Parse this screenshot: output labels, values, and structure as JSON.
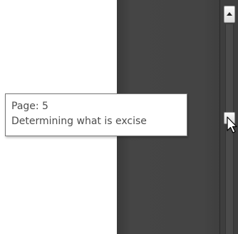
{
  "tooltip": {
    "page_label": "Page: 5",
    "heading": "Determining what is excise"
  },
  "scrollbar": {
    "up_arrow_icon": "triangle-up-icon"
  },
  "cursor": {
    "icon": "arrow-pointer-icon"
  },
  "colors": {
    "dark_pane": "#444444",
    "tooltip_border": "#767676",
    "tooltip_text": "#4d4d4d"
  }
}
